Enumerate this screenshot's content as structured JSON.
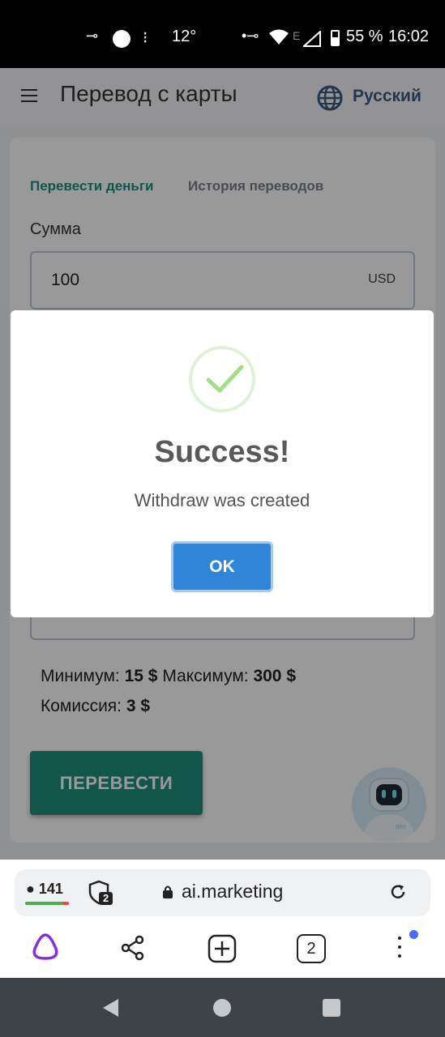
{
  "status_bar": {
    "temperature": "12°",
    "battery": "55 %",
    "time": "16:02",
    "network_letter": "E"
  },
  "app_bar": {
    "title": "Перевод с карты",
    "language": "Русский"
  },
  "tabs": [
    {
      "label": "Перевести деньги",
      "active": true
    },
    {
      "label": "История переводов",
      "active": false
    }
  ],
  "form": {
    "amount_label": "Сумма",
    "amount_value": "100",
    "currency": "USD"
  },
  "limits": {
    "min_label": "Минимум:",
    "min_value": "15 $",
    "max_label": "Максимум:",
    "max_value": "300 $",
    "fee_label": "Комиссия:",
    "fee_value": "3 $"
  },
  "transfer_button": "ПЕРЕВЕСТИ",
  "modal": {
    "title": "Success!",
    "message": "Withdraw was created",
    "ok_label": "OK"
  },
  "browser": {
    "chat_count": "141",
    "shield_count": "2",
    "url": "ai.marketing",
    "tabs_count": "2"
  },
  "colors": {
    "accent": "#1f8f7d",
    "ok_button": "#3085d6",
    "alice": "#8b2be2"
  }
}
